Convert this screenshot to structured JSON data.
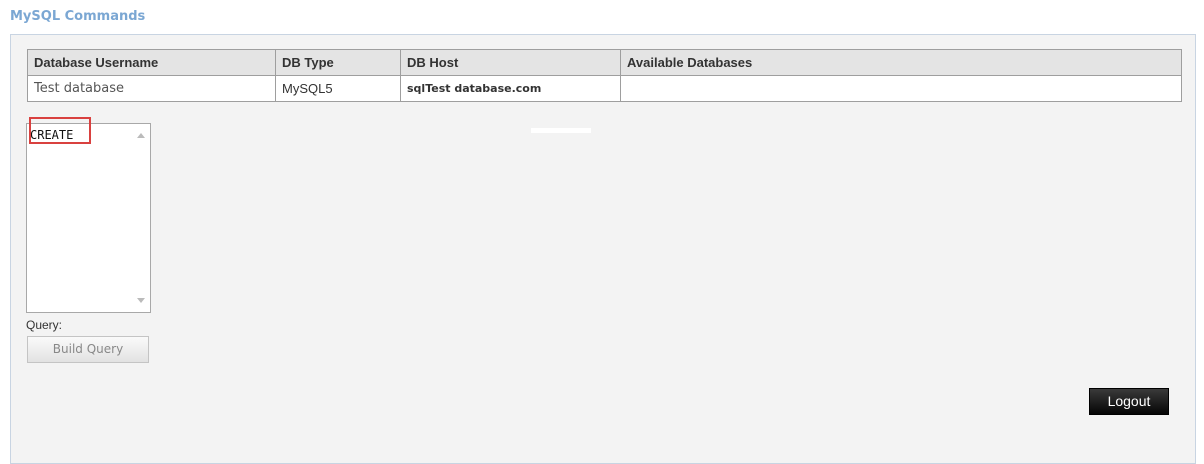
{
  "page": {
    "title": "MySQL Commands"
  },
  "table": {
    "headers": [
      "Database Username",
      "DB Type",
      "DB Host",
      "Available Databases"
    ],
    "row": {
      "username": "Test database",
      "db_type": "MySQL5",
      "host": "sqlTest database.com",
      "available": ""
    }
  },
  "command_list": {
    "options": [
      "CREATE"
    ],
    "selected": "CREATE"
  },
  "query": {
    "label": "Query:",
    "build_button_label": "Build Query"
  },
  "logout_label": "Logout",
  "colors": {
    "heading": "#7ba7d3",
    "highlight": "#d9413f",
    "panel_bg": "#f3f3f3",
    "logout_bg": "#000000"
  }
}
